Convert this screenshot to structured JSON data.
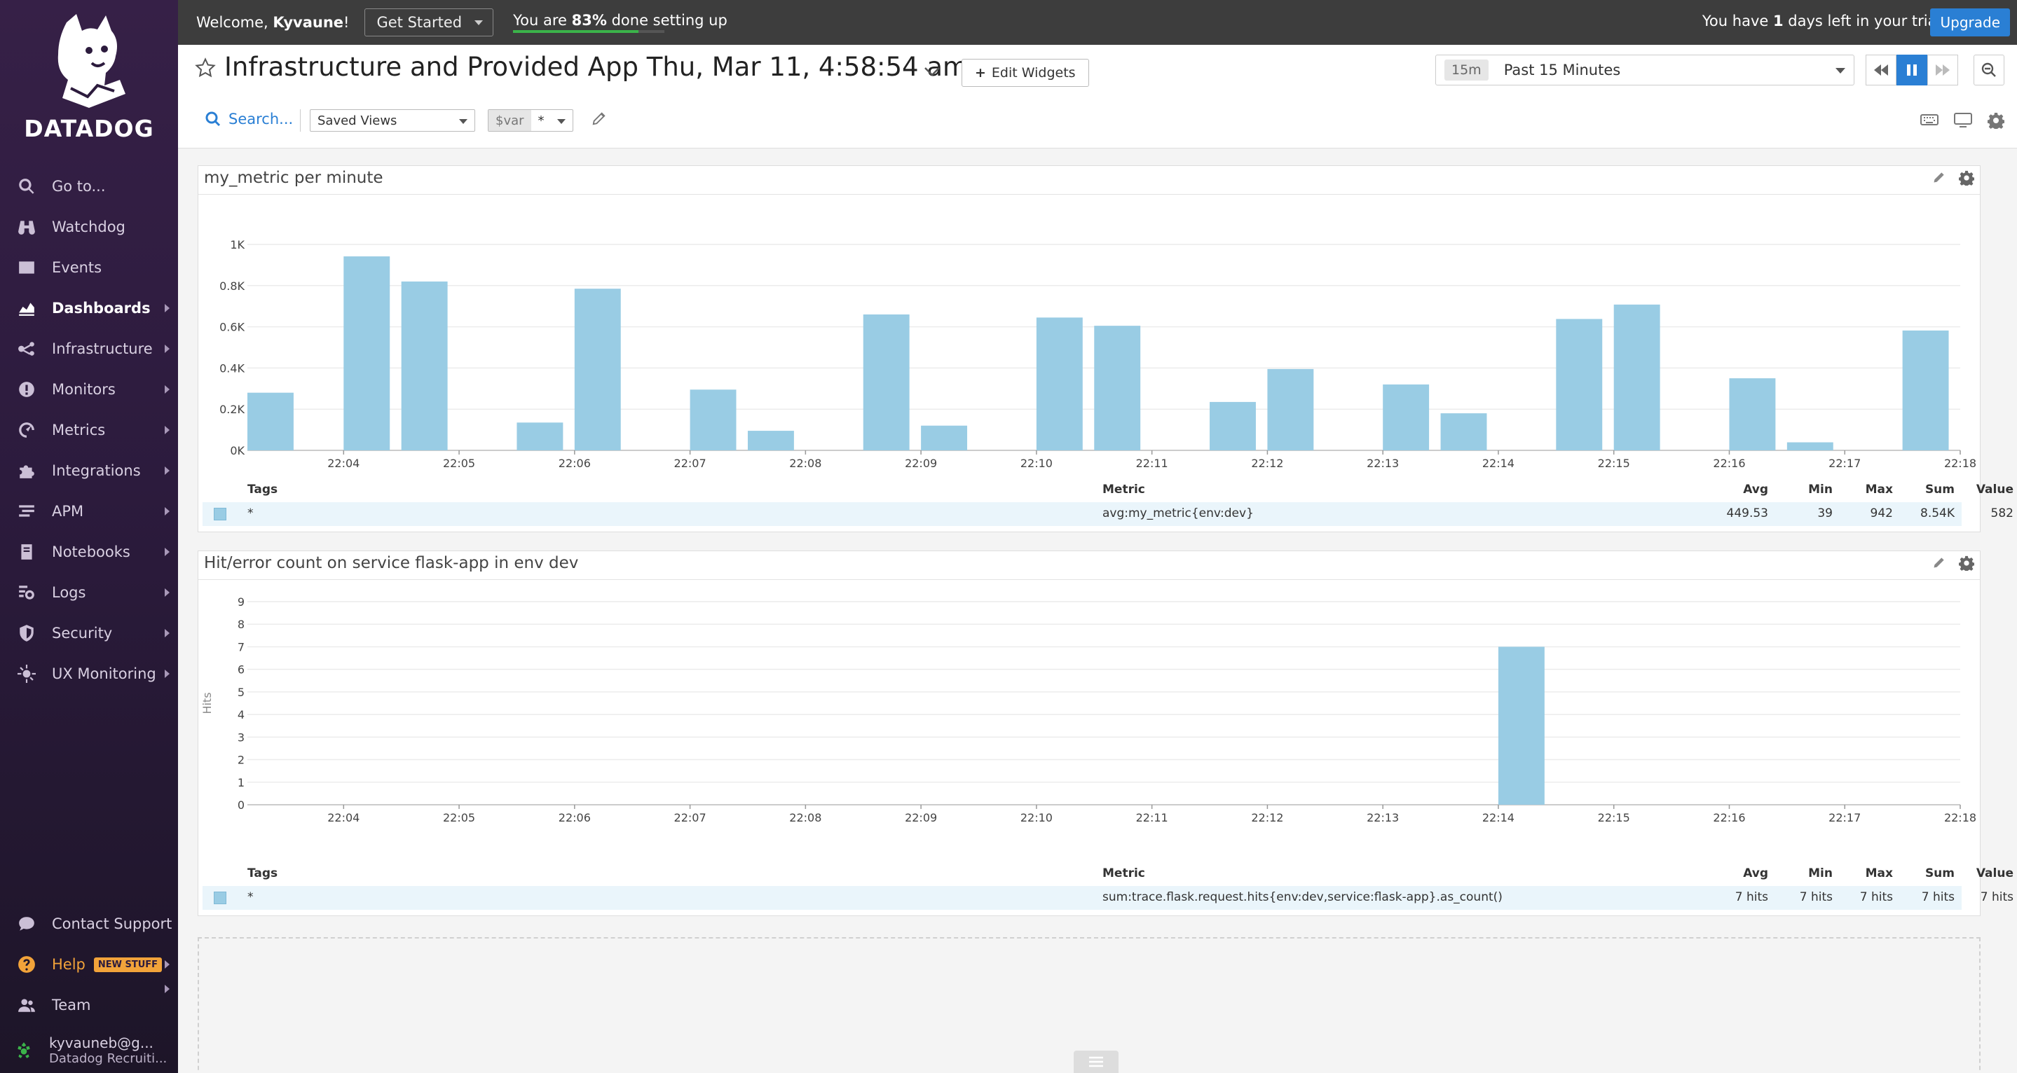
{
  "app": {
    "logo_text": "DATADOG"
  },
  "topbar": {
    "welcome_prefix": "Welcome, ",
    "user_name": "Kyvaune",
    "welcome_suffix": "!",
    "get_started": "Get Started",
    "progress_prefix": "You are ",
    "progress_percent_text": "83%",
    "progress_suffix": " done setting up",
    "progress_fraction": 0.83,
    "trial_prefix": "You have ",
    "trial_days": "1",
    "trial_suffix": " days left in your trial.",
    "upgrade": "Upgrade"
  },
  "sidebar": {
    "items": [
      {
        "label": "Go to...",
        "icon": "search-icon"
      },
      {
        "label": "Watchdog",
        "icon": "binoculars-icon"
      },
      {
        "label": "Events",
        "icon": "events-icon"
      },
      {
        "label": "Dashboards",
        "icon": "dashboard-icon",
        "active": true
      },
      {
        "label": "Infrastructure",
        "icon": "infrastructure-icon"
      },
      {
        "label": "Monitors",
        "icon": "monitor-icon"
      },
      {
        "label": "Metrics",
        "icon": "metrics-icon"
      },
      {
        "label": "Integrations",
        "icon": "puzzle-icon"
      },
      {
        "label": "APM",
        "icon": "apm-icon"
      },
      {
        "label": "Notebooks",
        "icon": "notebook-icon"
      },
      {
        "label": "Logs",
        "icon": "logs-icon"
      },
      {
        "label": "Security",
        "icon": "shield-icon"
      },
      {
        "label": "UX Monitoring",
        "icon": "ux-icon"
      }
    ],
    "bottom": {
      "contact": "Contact Support",
      "help": "Help",
      "new_stuff": "NEW STUFF",
      "team": "Team",
      "user_email": "kyvauneb@g...",
      "user_org": "Datadog Recruiti..."
    }
  },
  "header": {
    "title": "Infrastructure and Provided App Thu, Mar 11, 4:58:54 am",
    "edit_widgets": "Edit Widgets",
    "time_badge": "15m",
    "time_label": "Past 15 Minutes",
    "search": "Search...",
    "saved_views": "Saved Views",
    "var_key": "$var",
    "var_value": "*"
  },
  "widgets": {
    "w1": {
      "title": "my_metric per minute",
      "legend": {
        "headers": {
          "tags": "Tags",
          "metric": "Metric",
          "avg": "Avg",
          "min": "Min",
          "max": "Max",
          "sum": "Sum",
          "value": "Value"
        },
        "row": {
          "tags": "*",
          "metric": "avg:my_metric{env:dev}",
          "avg": "449.53",
          "min": "39",
          "max": "942",
          "sum": "8.54K",
          "value": "582"
        }
      }
    },
    "w2": {
      "title": "Hit/error count on service flask-app in env dev",
      "legend": {
        "headers": {
          "tags": "Tags",
          "metric": "Metric",
          "avg": "Avg",
          "min": "Min",
          "max": "Max",
          "sum": "Sum",
          "value": "Value"
        },
        "row": {
          "tags": "*",
          "metric": "sum:trace.flask.request.hits{env:dev,service:flask-app}.as_count()",
          "avg": "7 hits",
          "min": "7 hits",
          "max": "7 hits",
          "sum": "7 hits",
          "value": "7 hits"
        }
      }
    }
  },
  "colors": {
    "bar": "#99cce4",
    "accent": "#2a7fd4",
    "sidebar": "#2c1b3d"
  },
  "chart_data": [
    {
      "type": "bar",
      "title": "my_metric per minute",
      "x_ticks": [
        "22:04",
        "22:05",
        "22:06",
        "22:07",
        "22:08",
        "22:09",
        "22:10",
        "22:11",
        "22:12",
        "22:13",
        "22:14",
        "22:15",
        "22:16",
        "22:17",
        "22:18"
      ],
      "y_ticks": [
        "0K",
        "0.2K",
        "0.4K",
        "0.6K",
        "0.8K",
        "1K"
      ],
      "ylim": [
        0,
        1000
      ],
      "x_range": [
        "22:03:10",
        "22:18:00"
      ],
      "bar_width_sec": 24,
      "series": [
        {
          "bars": [
            {
              "t": "22:03:10",
              "v": 280
            },
            {
              "t": "22:04:00",
              "v": 942
            },
            {
              "t": "22:04:30",
              "v": 820
            },
            {
              "t": "22:05:30",
              "v": 135
            },
            {
              "t": "22:06:00",
              "v": 785
            },
            {
              "t": "22:07:00",
              "v": 295
            },
            {
              "t": "22:07:30",
              "v": 95
            },
            {
              "t": "22:08:30",
              "v": 660
            },
            {
              "t": "22:09:00",
              "v": 120
            },
            {
              "t": "22:10:00",
              "v": 645
            },
            {
              "t": "22:10:30",
              "v": 605
            },
            {
              "t": "22:11:30",
              "v": 235
            },
            {
              "t": "22:12:00",
              "v": 395
            },
            {
              "t": "22:13:00",
              "v": 320
            },
            {
              "t": "22:13:30",
              "v": 180
            },
            {
              "t": "22:14:30",
              "v": 638
            },
            {
              "t": "22:15:00",
              "v": 708
            },
            {
              "t": "22:16:00",
              "v": 350
            },
            {
              "t": "22:16:30",
              "v": 39
            },
            {
              "t": "22:17:30",
              "v": 582
            }
          ]
        }
      ],
      "grid": true
    },
    {
      "type": "bar",
      "title": "Hit/error count on service flask-app in env dev",
      "ylabel": "Hits",
      "x_ticks": [
        "22:04",
        "22:05",
        "22:06",
        "22:07",
        "22:08",
        "22:09",
        "22:10",
        "22:11",
        "22:12",
        "22:13",
        "22:14",
        "22:15",
        "22:16",
        "22:17",
        "22:18"
      ],
      "y_ticks": [
        "0",
        "1",
        "2",
        "3",
        "4",
        "5",
        "6",
        "7",
        "8",
        "9"
      ],
      "ylim": [
        0,
        9
      ],
      "x_range": [
        "22:03:10",
        "22:18:00"
      ],
      "bar_width_sec": 24,
      "series": [
        {
          "bars": [
            {
              "t": "22:14:00",
              "v": 7
            }
          ]
        }
      ],
      "grid": true
    }
  ]
}
